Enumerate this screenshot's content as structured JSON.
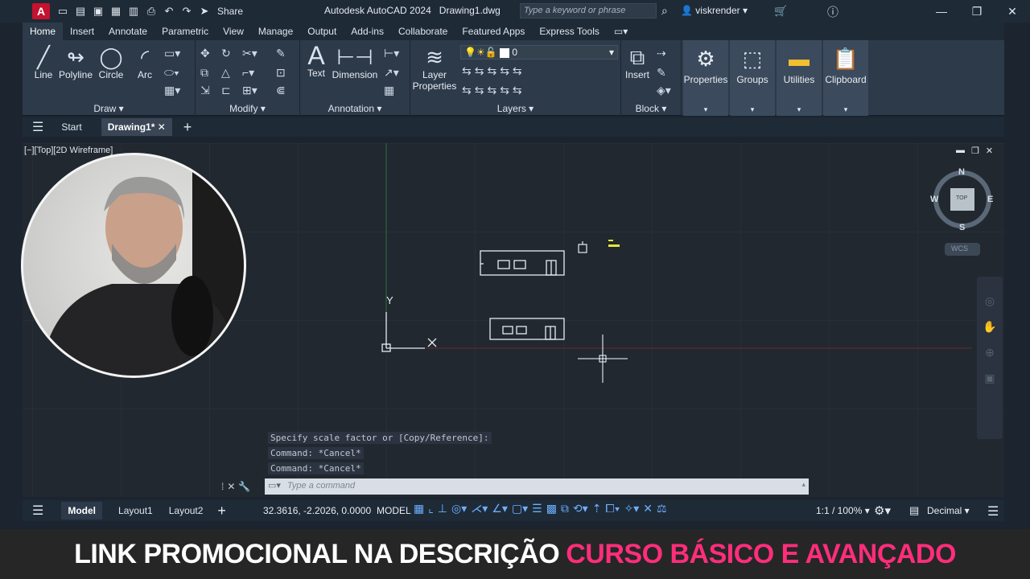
{
  "titlebar": {
    "logo": "A",
    "share": "Share",
    "title": "Autodesk AutoCAD 2024",
    "file": "Drawing1.dwg",
    "search_placeholder": "Type a keyword or phrase",
    "user": "viskrender"
  },
  "ribbon_tabs": [
    "Home",
    "Insert",
    "Annotate",
    "Parametric",
    "View",
    "Manage",
    "Output",
    "Add-ins",
    "Collaborate",
    "Featured Apps",
    "Express Tools"
  ],
  "ribbon": {
    "draw": {
      "title": "Draw",
      "tools": [
        "Line",
        "Polyline",
        "Circle",
        "Arc"
      ]
    },
    "modify": {
      "title": "Modify"
    },
    "annotation": {
      "title": "Annotation",
      "tools": [
        "Text",
        "Dimension"
      ]
    },
    "layers": {
      "title": "Layers",
      "tool": "Layer Properties",
      "current_layer": "0"
    },
    "block": {
      "title": "Block",
      "tool": "Insert"
    },
    "right_buttons": [
      "Properties",
      "Groups",
      "Utilities",
      "Clipboard"
    ]
  },
  "file_tabs": {
    "start": "Start",
    "active": "Drawing1*"
  },
  "viewport": {
    "label": "[−][Top][2D Wireframe]",
    "compass": {
      "n": "N",
      "s": "S",
      "e": "E",
      "w": "W",
      "top": "TOP",
      "wcs": "WCS"
    },
    "ucs": {
      "x": "X",
      "y": "Y"
    }
  },
  "command": {
    "history": [
      "Specify scale factor or [Copy/Reference]:",
      "Command: *Cancel*",
      "Command: *Cancel*"
    ],
    "placeholder": "Type a command"
  },
  "statusbar": {
    "layouts": [
      "Model",
      "Layout1",
      "Layout2"
    ],
    "coords": "32.3616, -2.2026, 0.0000",
    "model": "MODEL",
    "scale": "1:1 / 100%",
    "units": "Decimal"
  },
  "banner": {
    "white": "LINK PROMOCIONAL NA DESCRIÇÃO",
    "pink": "CURSO BÁSICO E AVANÇADO"
  },
  "colors": {
    "accent": "#2d3a4a",
    "banner_pink": "#ff2d7a",
    "canvas": "#212830"
  }
}
